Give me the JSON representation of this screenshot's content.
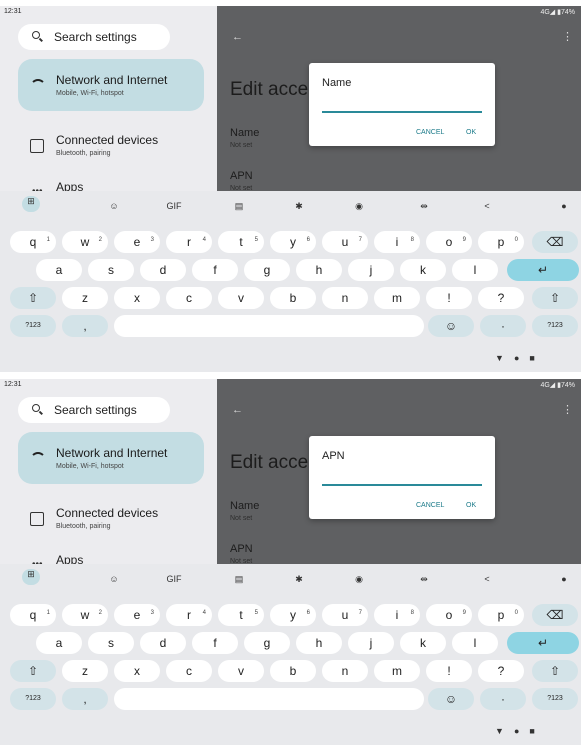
{
  "status": {
    "time": "12:31",
    "right": "4G◢ ▮74%"
  },
  "search": {
    "label": "Search settings"
  },
  "items": [
    {
      "title": "Network and Internet",
      "subtitle": "Mobile, Wi-Fi, hotspot"
    },
    {
      "title": "Connected devices",
      "subtitle": "Bluetooth, pairing"
    }
  ],
  "apps": "Apps",
  "edit": "Edit acce",
  "fields": {
    "name": "Name",
    "name_sub": "Not set",
    "apn": "APN",
    "apn_sub": "Not set"
  },
  "dialogs": [
    {
      "title": "Name",
      "cancel": "CANCEL",
      "ok": "OK"
    },
    {
      "title": "APN",
      "cancel": "CANCEL",
      "ok": "OK"
    }
  ],
  "toolbar": [
    "GIF"
  ],
  "keys": {
    "row1": [
      {
        "k": "q",
        "n": "1"
      },
      {
        "k": "w",
        "n": "2"
      },
      {
        "k": "e",
        "n": "3"
      },
      {
        "k": "r",
        "n": "4"
      },
      {
        "k": "t",
        "n": "5"
      },
      {
        "k": "y",
        "n": "6"
      },
      {
        "k": "u",
        "n": "7"
      },
      {
        "k": "i",
        "n": "8"
      },
      {
        "k": "o",
        "n": "9"
      },
      {
        "k": "p",
        "n": "0"
      }
    ],
    "row2": [
      "a",
      "s",
      "d",
      "f",
      "g",
      "h",
      "j",
      "k",
      "l"
    ],
    "row3": [
      "z",
      "x",
      "c",
      "v",
      "b",
      "n",
      "m",
      "!",
      "?"
    ],
    "sym": "?123",
    "comma": ",",
    "dot": "·"
  }
}
